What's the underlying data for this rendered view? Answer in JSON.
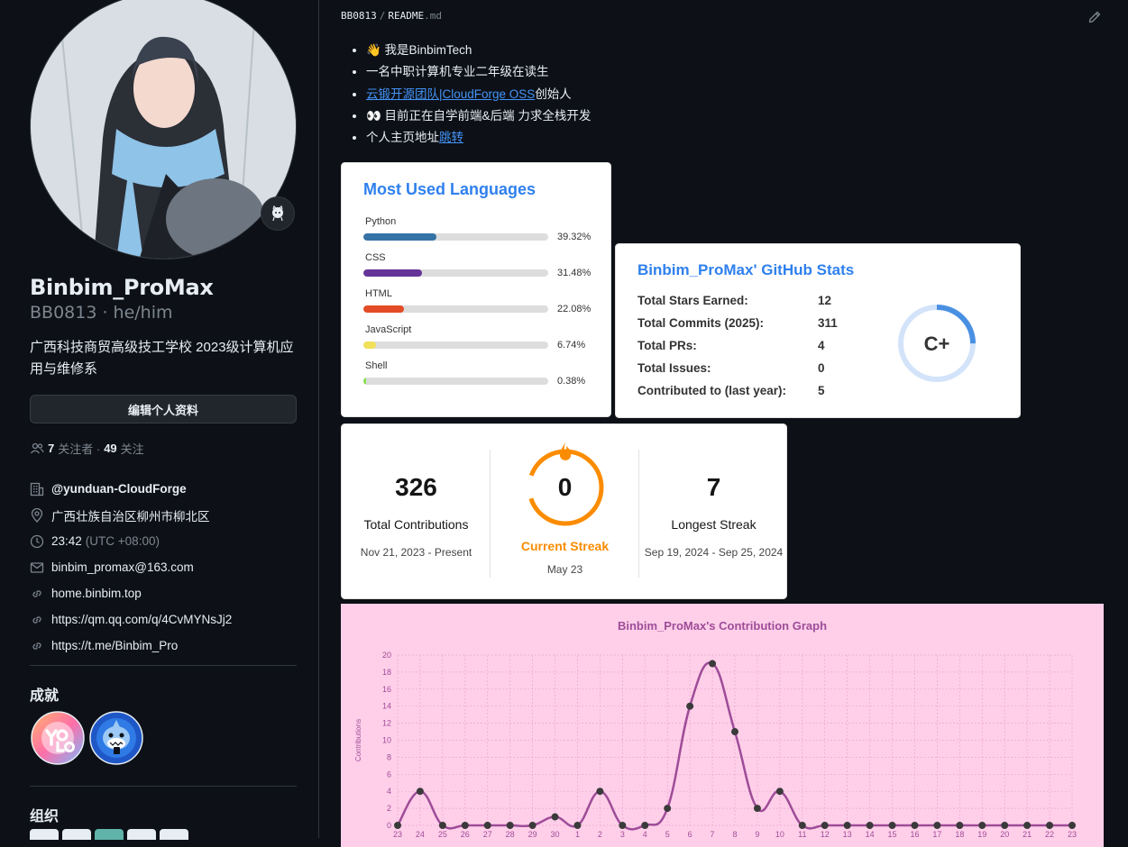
{
  "profile": {
    "name": "Binbim_ProMax",
    "login_pronouns": "BB0813 · he/him",
    "bio": "广西科技商贸高级技工学校 2023级计算机应用与维修系",
    "edit_label": "编辑个人资料",
    "followers": "7",
    "followers_label": "关注者 ·",
    "following": "49",
    "following_label": "关注",
    "org": "@yunduan-CloudForge",
    "location": "广西壮族自治区柳州市柳北区",
    "time": "23:42",
    "timezone": "(UTC +08:00)",
    "email": "binbim_promax@163.com",
    "links": [
      "home.binbim.top",
      "https://qm.qq.com/q/4CvMYNsJj2",
      "https://t.me/Binbim_Pro"
    ],
    "achievements_title": "成就",
    "orgs_title": "组织"
  },
  "readme": {
    "owner": "BB0813",
    "file_name": "README",
    "file_ext": ".md",
    "items": {
      "hello": "👋 我是BinbimTech",
      "student": "一名中职计算机专业二年级在读生",
      "team_link": "云锻开源团队|CloudForge OSS",
      "founder": "创始人",
      "learning": "👀 目前正在自学前端&后端 力求全栈开发",
      "homepage": "个人主页地址",
      "jump": "跳转"
    }
  },
  "languages_card": {
    "title": "Most Used Languages",
    "items": [
      {
        "name": "Python",
        "percent": "39.32%",
        "value": 39.32,
        "color": "#3572A5"
      },
      {
        "name": "CSS",
        "percent": "31.48%",
        "value": 31.48,
        "color": "#663399"
      },
      {
        "name": "HTML",
        "percent": "22.08%",
        "value": 22.08,
        "color": "#e34c26"
      },
      {
        "name": "JavaScript",
        "percent": "6.74%",
        "value": 6.74,
        "color": "#f1e05a"
      },
      {
        "name": "Shell",
        "percent": "0.38%",
        "value": 0.38,
        "color": "#89e051"
      }
    ]
  },
  "stats_card": {
    "title": "Binbim_ProMax' GitHub Stats",
    "rows": [
      {
        "label": "Total Stars Earned:",
        "value": "12"
      },
      {
        "label": "Total Commits (2025):",
        "value": "311"
      },
      {
        "label": "Total PRs:",
        "value": "4"
      },
      {
        "label": "Total Issues:",
        "value": "0"
      },
      {
        "label": "Contributed to (last year):",
        "value": "5"
      }
    ],
    "rank": "C+",
    "rank_progress": 0.25
  },
  "streak_card": {
    "total": {
      "value": "326",
      "label": "Total Contributions",
      "range": "Nov 21, 2023 - Present"
    },
    "current": {
      "value": "0",
      "label": "Current Streak",
      "range": "May 23"
    },
    "longest": {
      "value": "7",
      "label": "Longest Streak",
      "range": "Sep 19, 2024 - Sep 25, 2024"
    }
  },
  "chart_data": {
    "type": "line",
    "title": "Binbim_ProMax's Contribution Graph",
    "ylabel": "Contributions",
    "xlabel": "",
    "ylim": [
      0,
      20
    ],
    "yticks": [
      0,
      2,
      4,
      6,
      8,
      10,
      12,
      14,
      16,
      18,
      20
    ],
    "x": [
      "23",
      "24",
      "25",
      "26",
      "27",
      "28",
      "29",
      "30",
      "1",
      "2",
      "3",
      "4",
      "5",
      "6",
      "7",
      "8",
      "9",
      "10",
      "11",
      "12",
      "13",
      "14",
      "15",
      "16",
      "17",
      "18",
      "19",
      "20",
      "21",
      "22",
      "23"
    ],
    "series": [
      {
        "values": [
          0,
          4,
          0,
          0,
          0,
          0,
          0,
          1,
          0,
          4,
          0,
          0,
          2,
          14,
          19,
          11,
          2,
          4,
          0,
          0,
          0,
          0,
          0,
          0,
          0,
          0,
          0,
          0,
          0,
          0,
          0
        ]
      }
    ]
  }
}
